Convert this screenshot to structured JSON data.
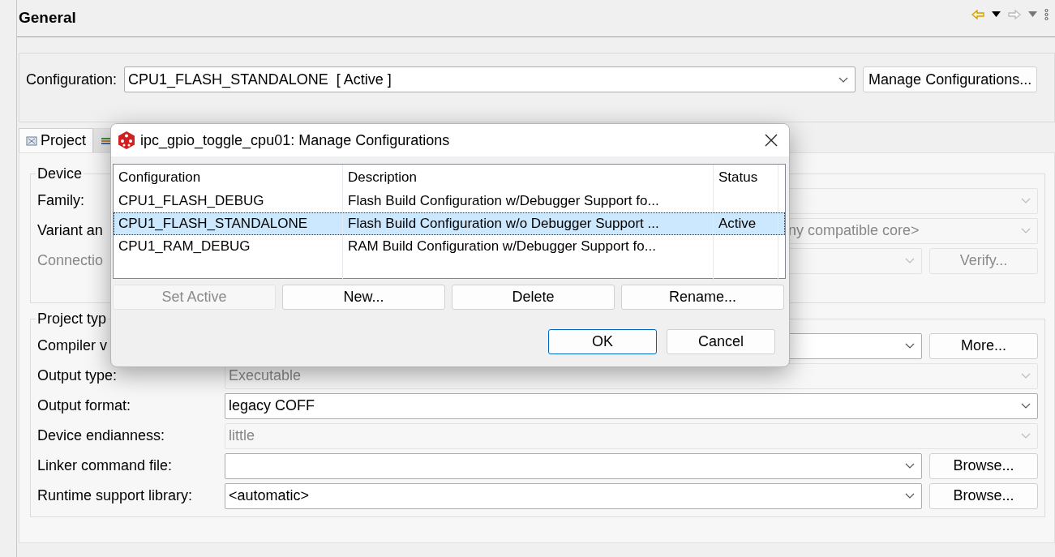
{
  "page_title": "General",
  "configuration": {
    "label": "Configuration:",
    "value": "CPU1_FLASH_STANDALONE  [ Active ]",
    "button": "Manage Configurations..."
  },
  "tabs": [
    {
      "kind": "labeled",
      "label": "Project",
      "selected": true
    },
    {
      "kind": "icon_only",
      "selected": false
    }
  ],
  "device": {
    "title": "Device",
    "rows": [
      {
        "label": "Family:",
        "label_disabled": false,
        "field_disabled": true
      },
      {
        "label": "Variant an",
        "label_disabled": false,
        "field_disabled": true,
        "value": "ny compatible core>"
      },
      {
        "label": "Connectio",
        "label_disabled": true,
        "field_disabled": true,
        "button": "Verify...",
        "button_disabled": true
      }
    ]
  },
  "project_type": {
    "title": "Project typ",
    "rows": [
      {
        "label": "Compiler v",
        "label_disabled": false,
        "field_disabled": false,
        "button": "More...",
        "button_disabled": false
      },
      {
        "label": "Output type:",
        "label_disabled": false,
        "field_disabled": true,
        "value": "Executable"
      },
      {
        "label": "Output format:",
        "label_disabled": false,
        "field_disabled": false,
        "value": "legacy COFF"
      },
      {
        "label": "Device endianness:",
        "label_disabled": false,
        "field_disabled": true,
        "value": "little"
      },
      {
        "label": "Linker command file:",
        "label_disabled": false,
        "field_disabled": false,
        "button": "Browse...",
        "button_disabled": false
      },
      {
        "label": "Runtime support library:",
        "label_disabled": false,
        "field_disabled": false,
        "value": "<automatic>",
        "button": "Browse...",
        "button_disabled": false
      }
    ]
  },
  "dialog": {
    "title": "ipc_gpio_toggle_cpu01: Manage Configurations",
    "table": {
      "columns": [
        "Configuration",
        "Description",
        "Status"
      ],
      "rows": [
        {
          "configuration": "CPU1_FLASH_DEBUG",
          "description": "Flash Build Configuration w/Debugger Support fo...",
          "selected": false
        },
        {
          "configuration": "CPU1_FLASH_STANDALONE",
          "description": "Flash Build Configuration w/o Debugger Support ...",
          "status": "Active",
          "selected": true
        },
        {
          "configuration": "CPU1_RAM_DEBUG",
          "description": "RAM Build Configuration w/Debugger Support fo...",
          "selected": false
        }
      ]
    },
    "buttons": [
      {
        "label": "Set Active",
        "disabled": true
      },
      {
        "label": "New...",
        "disabled": false
      },
      {
        "label": "Delete",
        "disabled": false
      },
      {
        "label": "Rename...",
        "disabled": false
      }
    ],
    "footer": [
      {
        "label": "OK",
        "default": true
      },
      {
        "label": "Cancel",
        "default": false
      }
    ]
  }
}
